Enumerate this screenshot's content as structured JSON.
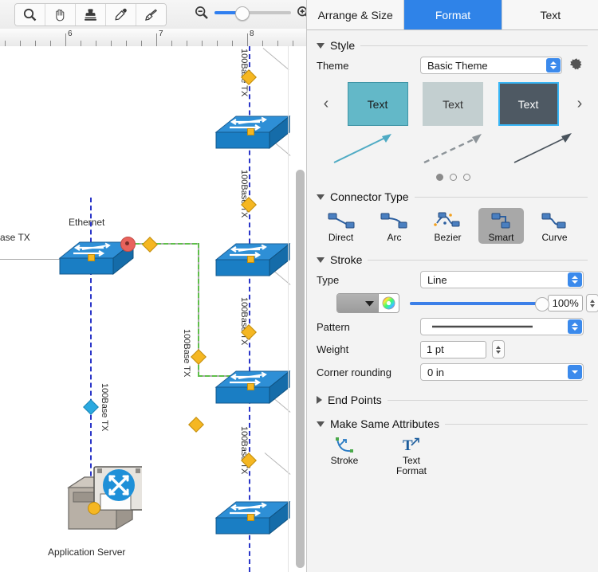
{
  "toolbar": {
    "tools": [
      {
        "name": "zoom-tool",
        "icon": "magnifier-icon"
      },
      {
        "name": "pan-tool",
        "icon": "hand-icon"
      },
      {
        "name": "stamp-tool",
        "icon": "stamp-icon"
      },
      {
        "name": "eyedropper-tool",
        "icon": "eyedropper-icon"
      },
      {
        "name": "paintbrush-tool",
        "icon": "paintbrush-icon"
      }
    ],
    "zoom_out_icon": "zoom-out-icon",
    "zoom_in_icon": "zoom-in-icon"
  },
  "ruler": {
    "unit_labels": [
      "6",
      "7",
      "8"
    ],
    "positions": [
      82,
      196,
      310
    ]
  },
  "canvas": {
    "nodes": [
      {
        "label": "Ethernet",
        "type": "switch"
      },
      {
        "label": "Application Server",
        "type": "server"
      }
    ],
    "connector_labels": [
      "100Base TX",
      "100Base TX",
      "100Base TX",
      "100Base TX",
      "100Base TX",
      "100Base TX",
      "ase TX"
    ]
  },
  "inspector": {
    "tabs": [
      {
        "label": "Arrange & Size",
        "active": false
      },
      {
        "label": "Format",
        "active": true
      },
      {
        "label": "Text",
        "active": false
      }
    ],
    "style": {
      "section_title": "Style",
      "theme_label": "Theme",
      "theme_value": "Basic Theme",
      "gear_icon": "gear-icon",
      "prev_icon": "chevron-left-icon",
      "next_icon": "chevron-right-icon",
      "swatches": [
        {
          "label": "Text",
          "fill": "#63b8c8",
          "selected": false
        },
        {
          "label": "Text",
          "fill": "#c3cfd0",
          "selected": false
        },
        {
          "label": "Text",
          "fill": "#4e5963",
          "selected": true
        }
      ],
      "page_dots": [
        true,
        false,
        false
      ]
    },
    "connector_type": {
      "section_title": "Connector Type",
      "items": [
        {
          "label": "Direct",
          "selected": false
        },
        {
          "label": "Arc",
          "selected": false
        },
        {
          "label": "Bezier",
          "selected": false
        },
        {
          "label": "Smart",
          "selected": true
        },
        {
          "label": "Curve",
          "selected": false
        }
      ]
    },
    "stroke": {
      "section_title": "Stroke",
      "type_label": "Type",
      "type_value": "Line",
      "color_well_name": "stroke-color-well",
      "color_wheel_name": "color-wheel-icon",
      "opacity_value": "100%",
      "pattern_label": "Pattern",
      "weight_label": "Weight",
      "weight_value": "1 pt",
      "corner_label": "Corner rounding",
      "corner_value": "0 in"
    },
    "end_points": {
      "section_title": "End Points",
      "expanded": false
    },
    "make_same": {
      "section_title": "Make Same Attributes",
      "items": [
        {
          "label": "Stroke",
          "icon": "stroke-same-icon"
        },
        {
          "label": "Text\nFormat",
          "line1": "Text",
          "line2": "Format",
          "icon": "text-format-same-icon"
        }
      ]
    }
  },
  "colors": {
    "accent_blue": "#2f83e8",
    "selected_swatch_border": "#38b5f5",
    "handle_yellow": "#f5b722",
    "handle_blue": "#2aa9e0",
    "endpoint_red": "#e8635c",
    "connector_green": "#5fbf4a",
    "guide_blue": "#2a35c8",
    "switch_blue": "#1f76c4"
  }
}
